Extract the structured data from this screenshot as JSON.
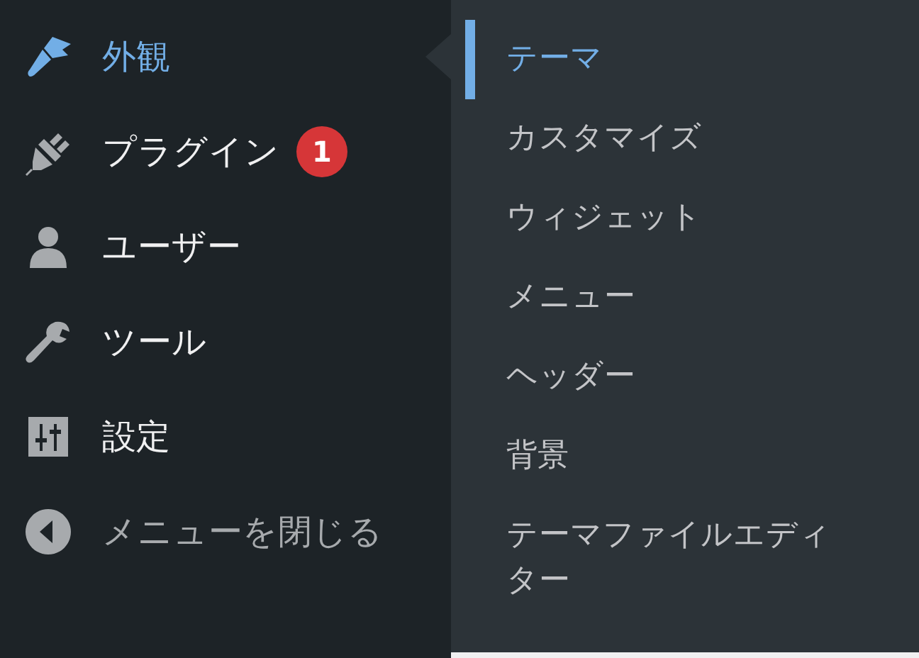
{
  "menu": [
    {
      "label": "外観",
      "kind": "brush",
      "selected": true
    },
    {
      "label": "プラグイン",
      "kind": "plug",
      "selected": false,
      "badge": "1"
    },
    {
      "label": "ユーザー",
      "kind": "user",
      "selected": false
    },
    {
      "label": "ツール",
      "kind": "wrench",
      "selected": false
    },
    {
      "label": "設定",
      "kind": "sliders",
      "selected": false
    }
  ],
  "collapse_button": {
    "label": "メニューを閉じる"
  },
  "submenu": [
    {
      "label": "テーマ",
      "selected": true
    },
    {
      "label": "カスタマイズ",
      "selected": false
    },
    {
      "label": "ウィジェット",
      "selected": false
    },
    {
      "label": "メニュー",
      "selected": false
    },
    {
      "label": "ヘッダー",
      "selected": false
    },
    {
      "label": "背景",
      "selected": false
    },
    {
      "label": "テーマファイルエディター",
      "selected": false
    }
  ]
}
